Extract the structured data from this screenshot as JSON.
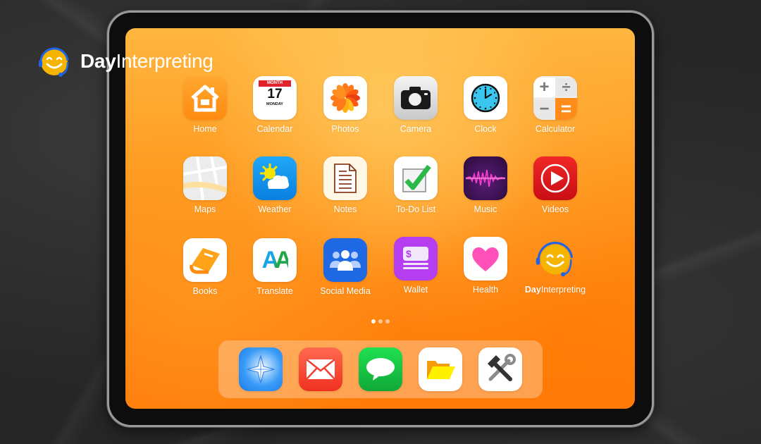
{
  "brand": {
    "bold": "Day",
    "regular": "Interpreting"
  },
  "apps": [
    {
      "label": "Home",
      "icon": "home-icon"
    },
    {
      "label": "Calendar",
      "icon": "calendar-icon",
      "month": "MONTH",
      "day": "17",
      "weekday": "MONDAY"
    },
    {
      "label": "Photos",
      "icon": "photos-icon"
    },
    {
      "label": "Camera",
      "icon": "camera-icon"
    },
    {
      "label": "Clock",
      "icon": "clock-icon"
    },
    {
      "label": "Calculator",
      "icon": "calculator-icon"
    },
    {
      "label": "Maps",
      "icon": "maps-icon"
    },
    {
      "label": "Weather",
      "icon": "weather-icon"
    },
    {
      "label": "Notes",
      "icon": "notes-icon"
    },
    {
      "label": "To-Do List",
      "icon": "todo-icon"
    },
    {
      "label": "Music",
      "icon": "music-icon"
    },
    {
      "label": "Videos",
      "icon": "videos-icon"
    },
    {
      "label": "Books",
      "icon": "books-icon"
    },
    {
      "label": "Translate",
      "icon": "translate-icon",
      "glyph": "AA"
    },
    {
      "label": "Social Media",
      "icon": "social-media-icon"
    },
    {
      "label": "Wallet",
      "icon": "wallet-icon",
      "glyph": "$"
    },
    {
      "label": "Health",
      "icon": "health-icon"
    },
    {
      "label_bold": "Day",
      "label_regular": "Interpreting",
      "icon": "dayinterpreting-icon"
    }
  ],
  "page_indicator": {
    "pages": 3,
    "current": 1
  },
  "dock": [
    {
      "icon": "compass-icon"
    },
    {
      "icon": "mail-icon"
    },
    {
      "icon": "messages-icon"
    },
    {
      "icon": "files-icon"
    },
    {
      "icon": "tools-icon"
    }
  ],
  "colors": {
    "accent": "#ff8a14",
    "brand_blue": "#1e64e6",
    "brand_yellow": "#f5b400"
  }
}
